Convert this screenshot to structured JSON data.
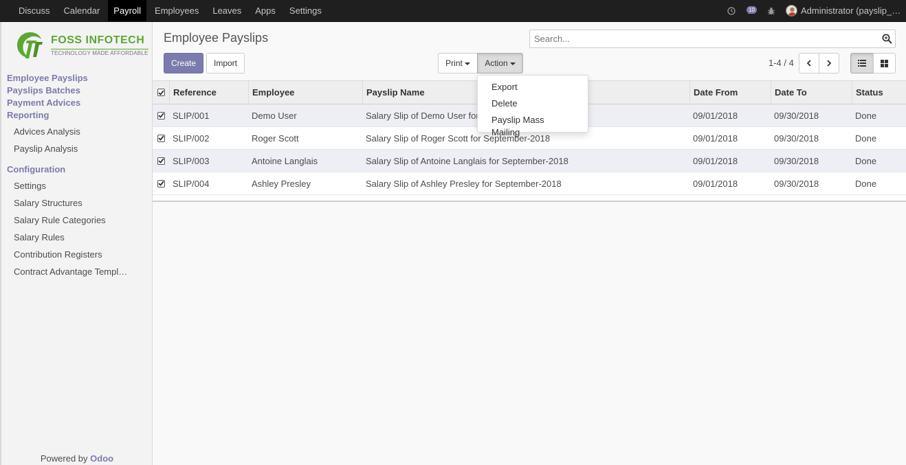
{
  "nav": {
    "items": [
      {
        "label": "Discuss",
        "active": false
      },
      {
        "label": "Calendar",
        "active": false
      },
      {
        "label": "Payroll",
        "active": true
      },
      {
        "label": "Employees",
        "active": false
      },
      {
        "label": "Leaves",
        "active": false
      },
      {
        "label": "Apps",
        "active": false
      },
      {
        "label": "Settings",
        "active": false
      }
    ],
    "messages_count": "10",
    "user_name": "Administrator (payslip_mass_mailing)"
  },
  "brand": {
    "logo_name": "FOSS INFOTECH",
    "logo_tagline": "TECHNOLOGY MADE AFFORDABLE"
  },
  "sidebar": {
    "sections": {
      "employee_payslips": "Employee Payslips",
      "payslip_batches": "Payslips Batches",
      "payment_advices": "Payment Advices",
      "reporting": "Reporting",
      "configuration": "Configuration"
    },
    "reporting_items": [
      "Advices Analysis",
      "Payslip Analysis"
    ],
    "configuration_items": [
      "Settings",
      "Salary Structures",
      "Salary Rule Categories",
      "Salary Rules",
      "Contribution Registers",
      "Contract Advantage Templates"
    ],
    "powered_by": "Powered by",
    "powered_brand": "Odoo"
  },
  "control": {
    "title": "Employee Payslips",
    "search_placeholder": "Search...",
    "create_label": "Create",
    "import_label": "Import",
    "print_label": "Print",
    "action_label": "Action",
    "pager": "1-4 / 4"
  },
  "action_menu": [
    "Export",
    "Delete",
    "Payslip Mass Mailing"
  ],
  "table": {
    "headers": [
      "Reference",
      "Employee",
      "Payslip Name",
      "Date From",
      "Date To",
      "Status"
    ],
    "rows": [
      [
        "SLIP/001",
        "Demo User",
        "Salary Slip of Demo User for September-2018",
        "09/01/2018",
        "09/30/2018",
        "Done"
      ],
      [
        "SLIP/002",
        "Roger Scott",
        "Salary Slip of Roger Scott for September-2018",
        "09/01/2018",
        "09/30/2018",
        "Done"
      ],
      [
        "SLIP/003",
        "Antoine Langlais",
        "Salary Slip of Antoine Langlais for September-2018",
        "09/01/2018",
        "09/30/2018",
        "Done"
      ],
      [
        "SLIP/004",
        "Ashley Presley",
        "Salary Slip of Ashley Presley for September-2018",
        "09/01/2018",
        "09/30/2018",
        "Done"
      ]
    ]
  },
  "colors": {
    "accent": "#7c7bad",
    "topbar": "#1f1f1f",
    "logo_green": "#5aa832"
  }
}
